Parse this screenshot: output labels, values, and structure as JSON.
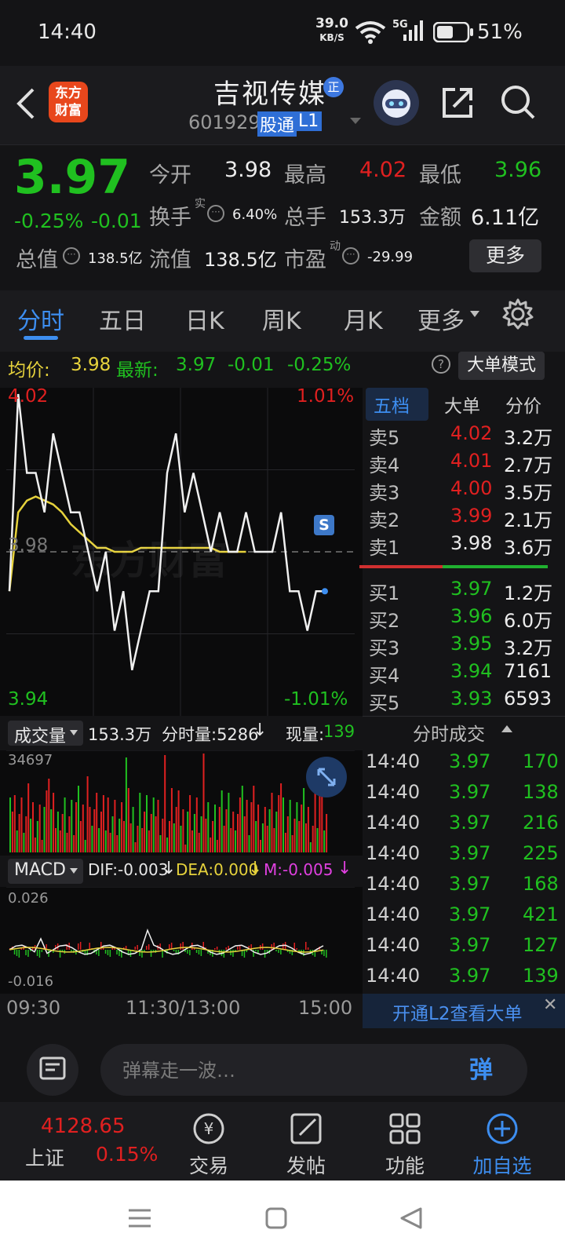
{
  "status": {
    "time": "14:40",
    "net_speed": "39.0",
    "net_unit": "KB/S",
    "network": "5G",
    "battery": "51%"
  },
  "header": {
    "logo_line1": "东方",
    "logo_line2": "财富",
    "stock_name": "吉视传媒",
    "badge": "正",
    "code": "601929",
    "tag_connect": "股通",
    "tag_level": "L1"
  },
  "quote": {
    "price": "3.97",
    "change_pct": "-0.25%",
    "change": "-0.01",
    "open_label": "今开",
    "open": "3.98",
    "high_label": "最高",
    "high": "4.02",
    "low_label": "最低",
    "low": "3.96",
    "turnover_label": "换手",
    "turnover_sup": "实",
    "turnover": "6.40%",
    "volume_label": "总手",
    "volume": "153.3万",
    "amount_label": "金额",
    "amount": "6.11亿",
    "mktcap_label": "总值",
    "mktcap": "138.5亿",
    "float_label": "流值",
    "float": "138.5亿",
    "pe_label": "市盈",
    "pe_sup": "动",
    "pe": "-29.99",
    "more_button": "更多"
  },
  "tabs": [
    "分时",
    "五日",
    "日K",
    "周K",
    "月K",
    "更多"
  ],
  "avgline": {
    "avg_label": "均价:",
    "avg": "3.98",
    "last_label": "最新:",
    "last": "3.97",
    "chg": "-0.01",
    "pct": "-0.25%",
    "help": "?",
    "big_order_mode": "大单模式"
  },
  "chart": {
    "top_price": "4.02",
    "top_pct": "1.01%",
    "bottom_price": "3.94",
    "bottom_pct": "-1.01%",
    "mid_price": "3.98",
    "watermark": "东方财富",
    "s_marker": "S",
    "vol_selector": "成交量",
    "vol_total": "153.3万",
    "minute_vol": "分时量:5286",
    "current_vol_label": "现量:",
    "current_vol": "139",
    "vol_max": "34697",
    "macd_selector": "MACD",
    "dif": "DIF:-0.003",
    "dea": "DEA:0.000",
    "m": "M:-0.005",
    "macd_top": "0.026",
    "macd_bottom": "-0.016",
    "time_start": "09:30",
    "time_mid": "11:30/13:00",
    "time_end": "15:00"
  },
  "chart_data": {
    "type": "line",
    "title": "",
    "xlabel": "",
    "ylabel": "",
    "ylim": [
      3.94,
      4.02
    ],
    "series": [
      {
        "values": [
          3.97,
          4.02,
          4.0,
          4.0,
          3.99,
          4.01,
          4.0,
          3.99,
          3.99,
          3.98,
          3.97,
          3.98,
          3.96,
          3.97,
          3.95,
          3.96,
          3.97,
          3.97,
          4.0,
          4.01,
          3.99,
          4.0,
          3.99,
          3.98,
          3.99,
          3.98,
          3.98,
          3.99,
          3.98,
          3.98,
          3.98,
          3.99,
          3.97,
          3.97,
          3.96,
          3.97,
          3.97
        ]
      },
      {
        "values": [
          3.97,
          3.99,
          3.993,
          3.994,
          3.993,
          3.992,
          3.99,
          3.987,
          3.985,
          3.983,
          3.981,
          3.981,
          3.98,
          3.98,
          3.98,
          3.981,
          3.981,
          3.981,
          3.981,
          3.981,
          3.981,
          3.981,
          3.981,
          3.981,
          3.98,
          3.98,
          3.98,
          3.98
        ]
      }
    ]
  },
  "book": {
    "tabs": [
      "五档",
      "大单",
      "分价"
    ],
    "asks": [
      {
        "label": "卖5",
        "price": "4.02",
        "vol": "3.2万"
      },
      {
        "label": "卖4",
        "price": "4.01",
        "vol": "2.7万"
      },
      {
        "label": "卖3",
        "price": "4.00",
        "vol": "3.5万"
      },
      {
        "label": "卖2",
        "price": "3.99",
        "vol": "2.1万"
      },
      {
        "label": "卖1",
        "price": "3.98",
        "vol": "3.6万"
      }
    ],
    "bids": [
      {
        "label": "买1",
        "price": "3.97",
        "vol": "1.2万"
      },
      {
        "label": "买2",
        "price": "3.96",
        "vol": "6.0万"
      },
      {
        "label": "买3",
        "price": "3.95",
        "vol": "3.2万"
      },
      {
        "label": "买4",
        "price": "3.94",
        "vol": "7161"
      },
      {
        "label": "买5",
        "price": "3.93",
        "vol": "6593"
      }
    ],
    "ticks_title": "分时成交",
    "ticks": [
      {
        "t": "14:40",
        "p": "3.97",
        "v": "170"
      },
      {
        "t": "14:40",
        "p": "3.97",
        "v": "138"
      },
      {
        "t": "14:40",
        "p": "3.97",
        "v": "216"
      },
      {
        "t": "14:40",
        "p": "3.97",
        "v": "225"
      },
      {
        "t": "14:40",
        "p": "3.97",
        "v": "168"
      },
      {
        "t": "14:40",
        "p": "3.97",
        "v": "421"
      },
      {
        "t": "14:40",
        "p": "3.97",
        "v": "127"
      },
      {
        "t": "14:40",
        "p": "3.97",
        "v": "139"
      }
    ],
    "l2_banner": "开通L2查看大单"
  },
  "danmu": {
    "placeholder": "弹幕走一波…",
    "send": "弹"
  },
  "bottomnav": {
    "index_value": "4128.65",
    "index_name": "上证",
    "index_pct": "0.15%",
    "items": [
      "交易",
      "发帖",
      "功能",
      "加自选"
    ]
  },
  "colors": {
    "up": "#e02020",
    "down": "#20c020",
    "avg": "#e6d23c",
    "accent": "#3d8ef0",
    "bg": "#141416"
  }
}
